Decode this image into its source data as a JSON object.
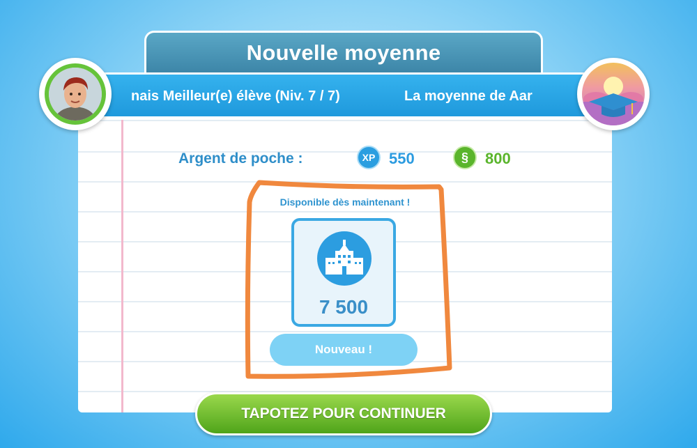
{
  "dialog": {
    "title": "Nouvelle moyenne",
    "banner_left": "nais Meilleur(e) élève (Niv. 7 / 7)",
    "banner_right": "La moyenne de Aar"
  },
  "rewards": {
    "label": "Argent de poche :",
    "xp_badge": "XP",
    "xp_value": "550",
    "coin_badge": "§",
    "coin_value": "800"
  },
  "unlock": {
    "heading": "Disponible dès maintenant !",
    "item_icon": "school-building-icon",
    "item_value": "7 500",
    "new_button": "Nouveau !"
  },
  "footer": {
    "continue_label": "TAPOTEZ POUR CONTINUER"
  },
  "colors": {
    "background": "#2fa9ec",
    "banner": "#1f99dc",
    "title_tab": "#3d86a8",
    "xp": "#2b9be0",
    "coins": "#5ab52c",
    "continue": "#4fa41a",
    "annotation": "#f0883e"
  },
  "icons": {
    "avatar": "sim-avatar",
    "goal": "graduation-cap-icon",
    "xp": "xp-icon",
    "coins": "simoleon-icon"
  }
}
